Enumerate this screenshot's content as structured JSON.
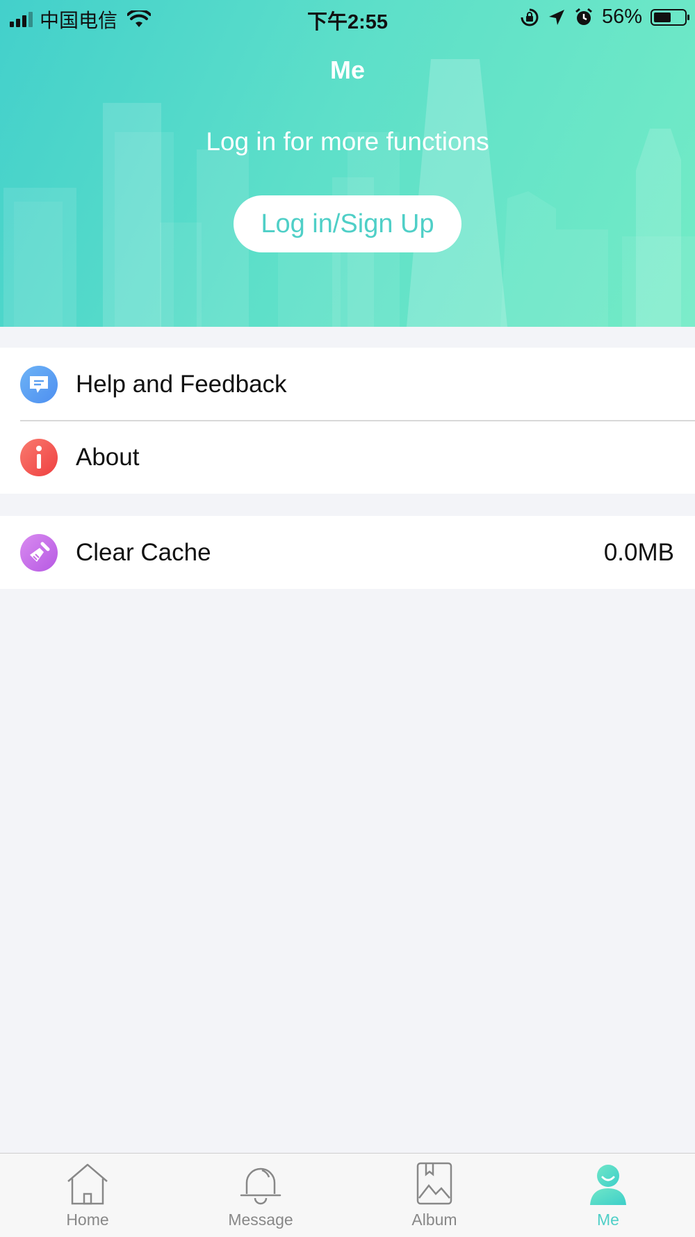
{
  "status_bar": {
    "carrier": "中国电信",
    "time": "下午2:55",
    "battery": "56%",
    "battery_level": 0.56,
    "icons": [
      "signal-icon",
      "wifi-icon",
      "rotation-lock-icon",
      "location-icon",
      "alarm-icon",
      "battery-icon"
    ]
  },
  "header": {
    "title": "Me",
    "prompt": "Log in for more functions",
    "login_button": "Log in/Sign Up"
  },
  "menu": {
    "group1": [
      {
        "label": "Help and Feedback",
        "icon": "chat-bubble-icon",
        "color": "#5b9ff0"
      },
      {
        "label": "About",
        "icon": "info-icon",
        "color": "#f0504d"
      }
    ],
    "group2": [
      {
        "label": "Clear Cache",
        "value": "0.0MB",
        "icon": "broom-icon",
        "color": "#c76ee6"
      }
    ]
  },
  "tabbar": {
    "tabs": [
      {
        "label": "Home",
        "icon": "home-icon"
      },
      {
        "label": "Message",
        "icon": "bell-icon"
      },
      {
        "label": "Album",
        "icon": "album-icon"
      },
      {
        "label": "Me",
        "icon": "person-icon",
        "active": true
      }
    ],
    "active_color": "#4fcfc7"
  }
}
